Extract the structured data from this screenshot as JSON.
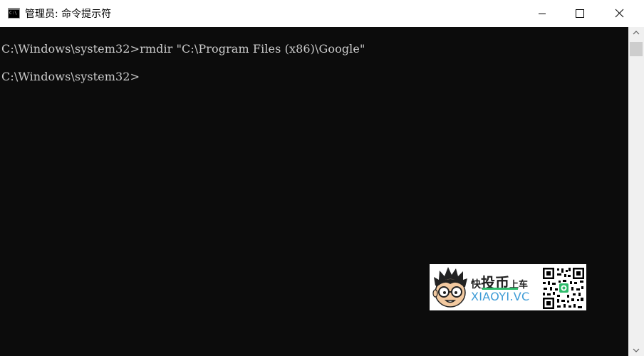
{
  "window": {
    "title": "管理员: 命令提示符",
    "icon": "cmd-icon",
    "icon_text": "C:\\",
    "controls": [
      "minimize-icon",
      "maximize-icon",
      "close-icon"
    ]
  },
  "console": {
    "lines": [
      "C:\\Windows\\system32>rmdir \"C:\\Program Files (x86)\\Google\"",
      "C:\\Windows\\system32>"
    ],
    "text_color": "#cccccc",
    "background": "#0c0c0c"
  },
  "watermark": {
    "logo": "cartoon-face-with-glasses",
    "line1": [
      "快",
      "投币",
      "上车"
    ],
    "line2": "XIAOYI.VC",
    "qr": "qr-code-icon",
    "accent_color": "#2dbb6a",
    "text_color": "#3d9bd6"
  }
}
